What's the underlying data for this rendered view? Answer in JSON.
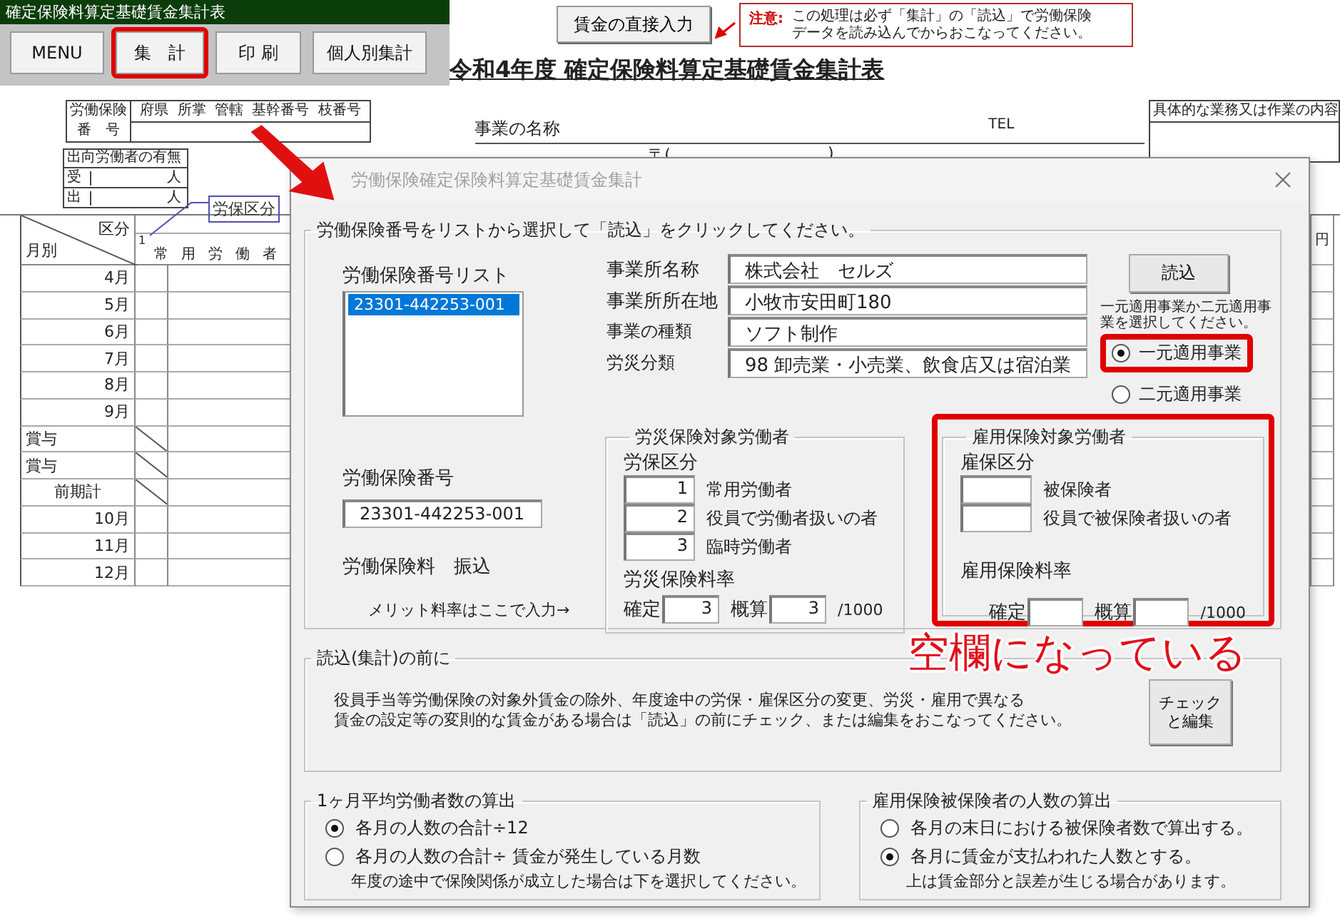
{
  "toolbar": {
    "title": "確定保険料算定基礎賃金集計表",
    "buttons": [
      {
        "label": "MENU",
        "highlighted": false
      },
      {
        "label": "集　計",
        "highlighted": true
      },
      {
        "label": "印 刷",
        "highlighted": false
      },
      {
        "label": "個人別集計",
        "highlighted": false
      }
    ]
  },
  "direct_input_button": "賃金の直接入力",
  "notice": {
    "label": "注意:",
    "lines": [
      "この処理は必ず「集計」の「読込」で労働保険",
      "データを読み込んでからおこなってください。"
    ]
  },
  "sheet_title": "令和4年度 確定保険料算定基礎賃金集計表",
  "insurance_number": {
    "label_lines": [
      "労働保険",
      "番　号"
    ],
    "parts": [
      "府県",
      "所掌",
      "管轄",
      "基幹番号",
      "枝番号"
    ]
  },
  "dispatched_workers": {
    "heading": "出向労働者の有無",
    "rows": [
      {
        "label": "受",
        "unit": "人"
      },
      {
        "label": "出",
        "unit": "人"
      }
    ]
  },
  "business_name_label": "事業の名称",
  "tel_label": "TEL",
  "postal_open": "〒(",
  "postal_close": ")",
  "work_content_heading": "具体的な業務又は作業の内容",
  "callout": "労保区分",
  "wage_table": {
    "corner_top": "区分",
    "corner_bottom": "月別",
    "column_number": "1",
    "column_heading": "常用労働者",
    "unit": "円",
    "rows": [
      {
        "label": "4月",
        "kind": "month"
      },
      {
        "label": "5月",
        "kind": "month"
      },
      {
        "label": "6月",
        "kind": "month"
      },
      {
        "label": "7月",
        "kind": "month"
      },
      {
        "label": "8月",
        "kind": "month"
      },
      {
        "label": "9月",
        "kind": "month"
      },
      {
        "label": "賞与",
        "kind": "bonus"
      },
      {
        "label": "賞与",
        "kind": "bonus"
      },
      {
        "label": "前期計",
        "kind": "subtotal"
      },
      {
        "label": "10月",
        "kind": "month"
      },
      {
        "label": "11月",
        "kind": "month"
      },
      {
        "label": "12月",
        "kind": "month"
      }
    ]
  },
  "dialog": {
    "title": "労働保険確定保険料算定基礎賃金集計",
    "select_group": {
      "legend": "労働保険番号をリストから選択して「読込」をクリックしてください。",
      "list_label": "労働保険番号リスト",
      "list_items": [
        {
          "text": "23301-442253-001",
          "selected": true
        }
      ],
      "number_label": "労働保険番号",
      "number_value": "23301-442253-001",
      "premium_label": "労働保険料　振込",
      "merit_note": "メリット料率はここで入力→",
      "info": [
        {
          "label": "事業所名称",
          "value": "株式会社　セルズ"
        },
        {
          "label": "事業所所在地",
          "value": "小牧市安田町180"
        },
        {
          "label": "事業の種類",
          "value": "ソフト制作"
        },
        {
          "label": "労災分類",
          "value": "98 卸売業・小売業、飲食店又は宿泊業"
        }
      ],
      "load_button": "読込",
      "scheme_hint": "一元適用事業か二元適用事業を選択してください。",
      "schemes": [
        {
          "label": "一元適用事業",
          "selected": true,
          "highlighted": true
        },
        {
          "label": "二元適用事業",
          "selected": false,
          "highlighted": false
        }
      ],
      "rosai": {
        "legend": "労災保険対象労働者",
        "subheading": "労保区分",
        "classes": [
          {
            "code": "1",
            "label": "常用労働者"
          },
          {
            "code": "2",
            "label": "役員で労働者扱いの者"
          },
          {
            "code": "3",
            "label": "臨時労働者"
          }
        ],
        "rate_heading": "労災保険料率",
        "fixed_label": "確定",
        "fixed_value": "3",
        "estimate_label": "概算",
        "estimate_value": "3",
        "unit": "/1000",
        "highlighted": false
      },
      "koyo": {
        "legend": "雇用保険対象労働者",
        "subheading": "雇保区分",
        "classes": [
          {
            "label": "被保険者"
          },
          {
            "label": "役員で被保険者扱いの者"
          }
        ],
        "rate_heading": "雇用保険料率",
        "fixed_label": "確定",
        "estimate_label": "概算",
        "unit": "/1000",
        "highlighted": true
      }
    },
    "before_load": {
      "legend": "読込(集計)の前に",
      "lines": [
        "役員手当等労働保険の対象外賃金の除外、年度途中の労保・雇保区分の変更、労災・雇用で異なる",
        "賃金の設定等の変則的な賃金がある場合は「読込」の前にチェック、または編集をおこなってください。"
      ],
      "button_lines": [
        "チェック",
        "と編集"
      ]
    },
    "average_workers": {
      "legend": "1ヶ月平均労働者数の算出",
      "options": [
        {
          "label": "各月の人数の合計÷12",
          "selected": true
        },
        {
          "label": "各月の人数の合計÷ 賃金が発生している月数",
          "selected": false,
          "note": "年度の途中で保険関係が成立した場合は下を選択してください。"
        }
      ]
    },
    "insured_count": {
      "legend": "雇用保険被保険者の人数の算出",
      "options": [
        {
          "label": "各月の末日における被保険者数で算出する。",
          "selected": false
        },
        {
          "label": "各月に賃金が支払われた人数とする。",
          "selected": true,
          "note": "上は賃金部分と誤差が生じる場合があります。"
        }
      ]
    }
  },
  "annotation": "空欄になっている"
}
